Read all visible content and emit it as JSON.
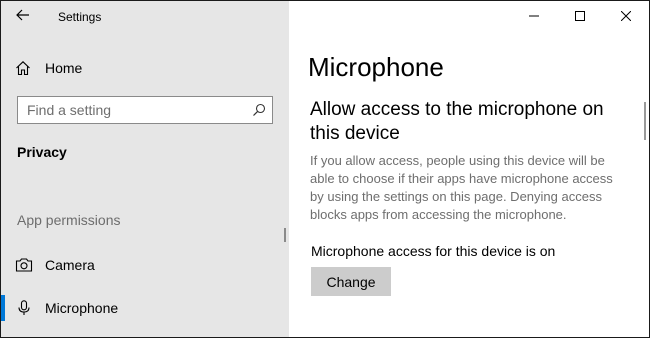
{
  "window": {
    "title": "Settings"
  },
  "titlebar": {
    "back_icon": "arrow-left-icon",
    "controls": [
      "minimize-icon",
      "maximize-icon",
      "close-icon"
    ]
  },
  "sidebar": {
    "home_label": "Home",
    "home_icon": "home-icon",
    "search": {
      "placeholder": "Find a setting",
      "value": "",
      "icon": "search-icon"
    },
    "section_heading": "Privacy",
    "group_label": "App permissions",
    "items": [
      {
        "label": "Camera",
        "icon": "camera-icon",
        "selected": false
      },
      {
        "label": "Microphone",
        "icon": "microphone-icon",
        "selected": true
      }
    ]
  },
  "main": {
    "page_title": "Microphone",
    "sub_heading": "Allow access to the microphone on this device",
    "description": "If you allow access, people using this device will be able to choose if their apps have microphone access by using the settings on this page. Denying access blocks apps from accessing the microphone.",
    "status": "Microphone access for this device is on",
    "change_button_label": "Change"
  },
  "colors": {
    "sidebar_bg": "#e6e6e6",
    "accent": "#0078d7",
    "button_bg": "#cccccc",
    "description_text": "#6e6e6e"
  }
}
